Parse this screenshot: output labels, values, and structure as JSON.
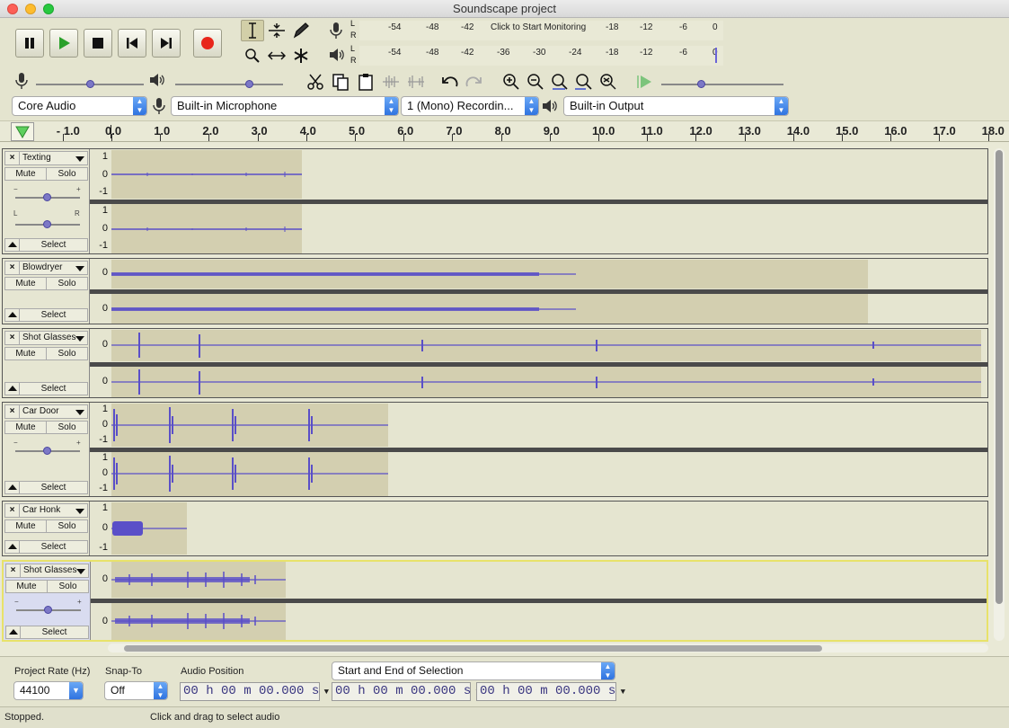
{
  "window": {
    "title": "Soundscape project"
  },
  "meters": {
    "record_scale": [
      "-54",
      "-48",
      "-42",
      "-18",
      "-12",
      "-6",
      "0"
    ],
    "record_prompt": "Click to Start Monitoring",
    "play_scale": [
      "-54",
      "-48",
      "-42",
      "-36",
      "-30",
      "-24",
      "-18",
      "-12",
      "-6",
      "0"
    ],
    "lr": [
      "L",
      "R"
    ]
  },
  "devices": {
    "host": "Core Audio",
    "input": "Built-in Microphone",
    "channels": "1 (Mono) Recordin...",
    "output": "Built-in Output"
  },
  "ruler": {
    "labels": [
      "- 1.0",
      "0.0",
      "1.0",
      "2.0",
      "3.0",
      "4.0",
      "5.0",
      "6.0",
      "7.0",
      "8.0",
      "9.0",
      "10.0",
      "11.0",
      "12.0",
      "13.0",
      "14.0",
      "15.0",
      "16.0",
      "17.0",
      "18.0"
    ]
  },
  "track_labels": {
    "mute": "Mute",
    "solo": "Solo",
    "select": "Select",
    "close": "×",
    "gain_minus": "−",
    "gain_plus": "+",
    "pan_l": "L",
    "pan_r": "R"
  },
  "tracks": [
    {
      "name": "Texting",
      "scale": [
        "1",
        "0",
        "-1"
      ]
    },
    {
      "name": "Blowdryer",
      "scale": [
        "0"
      ]
    },
    {
      "name": "Shot Glasses",
      "scale": [
        "0"
      ]
    },
    {
      "name": "Car Door",
      "scale": [
        "1",
        "0",
        "-1"
      ]
    },
    {
      "name": "Car Honk",
      "scale": [
        "1",
        "0",
        "-1"
      ]
    },
    {
      "name": "Shot Glasses",
      "scale": [
        "0"
      ]
    }
  ],
  "selection_bar": {
    "project_rate_label": "Project Rate (Hz)",
    "project_rate": "44100",
    "snap_to_label": "Snap-To",
    "snap_to": "Off",
    "audio_position_label": "Audio Position",
    "audio_position": "00 h 00 m 00.000 s",
    "selection_mode": "Start and End of Selection",
    "start": "00 h 00 m 00.000 s",
    "end": "00 h 00 m 00.000 s"
  },
  "status": {
    "state": "Stopped.",
    "hint": "Click and drag to select audio"
  },
  "colors": {
    "wave": "#5a4fc8",
    "clip": "#d3cfb0",
    "background": "#e9e9d6",
    "record": "#e8261b",
    "play": "#2aa02a"
  }
}
